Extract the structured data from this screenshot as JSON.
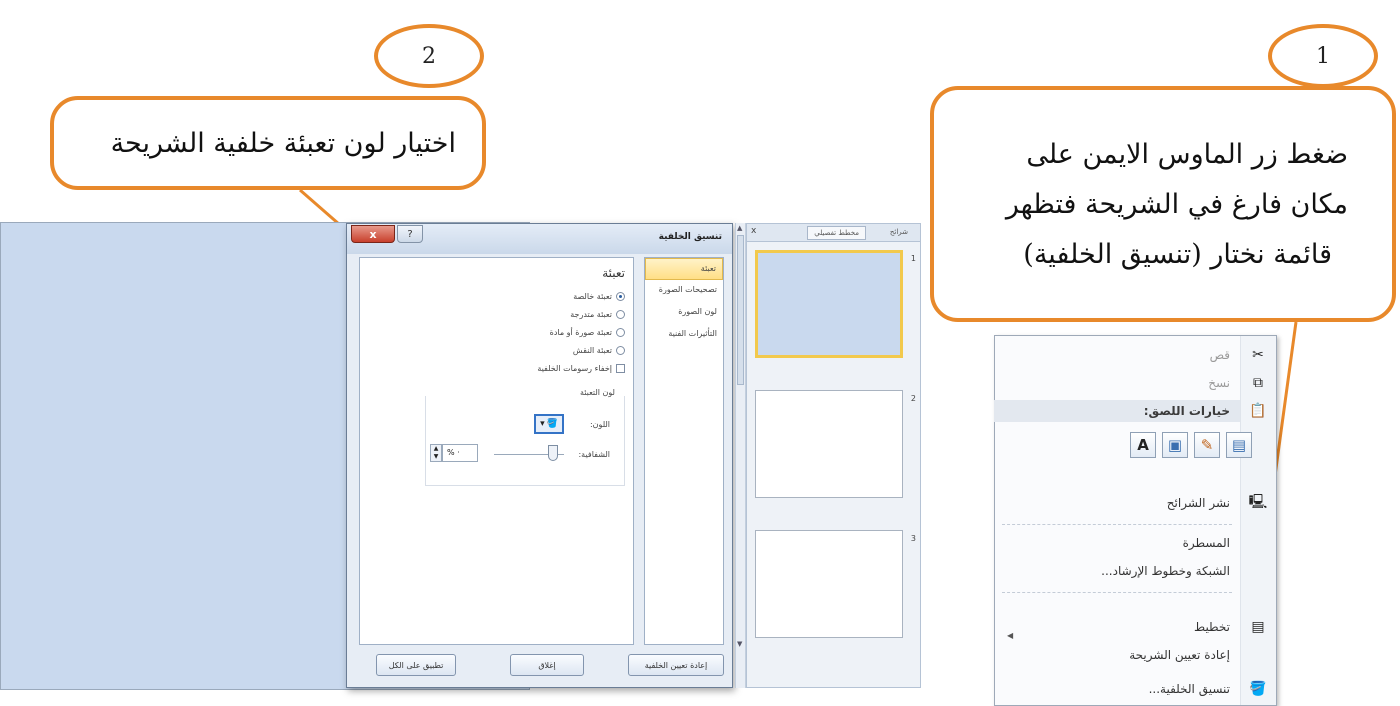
{
  "callouts": {
    "step1": {
      "number": "1",
      "lines": [
        "ضغط زر الماوس الايمن على",
        "مكان فارغ في الشريحة فتظهر",
        "قائمة نختار (تنسيق الخلفية)"
      ]
    },
    "step2": {
      "number": "2",
      "text": "اختيار لون تعبئة خلفية الشريحة"
    }
  },
  "dialog": {
    "title": "تنسيق الخلفية",
    "close_icon": "close-icon",
    "help_icon": "help-icon",
    "help_label": "?",
    "close_label": "x",
    "nav": [
      "تعبئة",
      "تصحيحات الصورة",
      "لون الصورة",
      "التأثيرات الفنية"
    ],
    "panel": {
      "heading": "تعبئة",
      "options": [
        "تعبئة خالصة",
        "تعبئة متدرجة",
        "تعبئة صورة أو مادة",
        "تعبئة النقش"
      ],
      "selected_option": 0,
      "hide_graphics_label": "إخفاء رسومات الخلفية",
      "fill_color_group": "لون التعبئة",
      "color_label": "اللون:",
      "transparency_label": "الشفافية:",
      "transparency_value": "% ·"
    },
    "buttons": {
      "reset": "إعادة تعيين الخلفية",
      "close": "إغلاق",
      "apply_all": "تطبيق على الكل"
    }
  },
  "slides_pane": {
    "tabs": [
      "شرائح",
      "مخطط تفصيلي"
    ],
    "close_label": "x",
    "thumbnails": [
      {
        "number": "1",
        "selected": true
      },
      {
        "number": "2",
        "selected": false
      },
      {
        "number": "3",
        "selected": false
      }
    ]
  },
  "context_menu": {
    "cut": "قص",
    "copy": "نسخ",
    "paste_options": "خيارات اللصق:",
    "paste_buttons": [
      "A",
      "picture",
      "brush",
      "text"
    ],
    "publish_slides": "نشر الشرائح",
    "ruler": "المسطرة",
    "grid_guides": "الشبكة وخطوط الإرشاد...",
    "layout": "تخطيط",
    "reset_slide": "إعادة تعيين الشريحة",
    "format_background": "تنسيق الخلفية..."
  },
  "colors": {
    "accent": "#e8892b",
    "slide_background": "#c9d9ee",
    "selection_highlight": "#f2c94c"
  }
}
